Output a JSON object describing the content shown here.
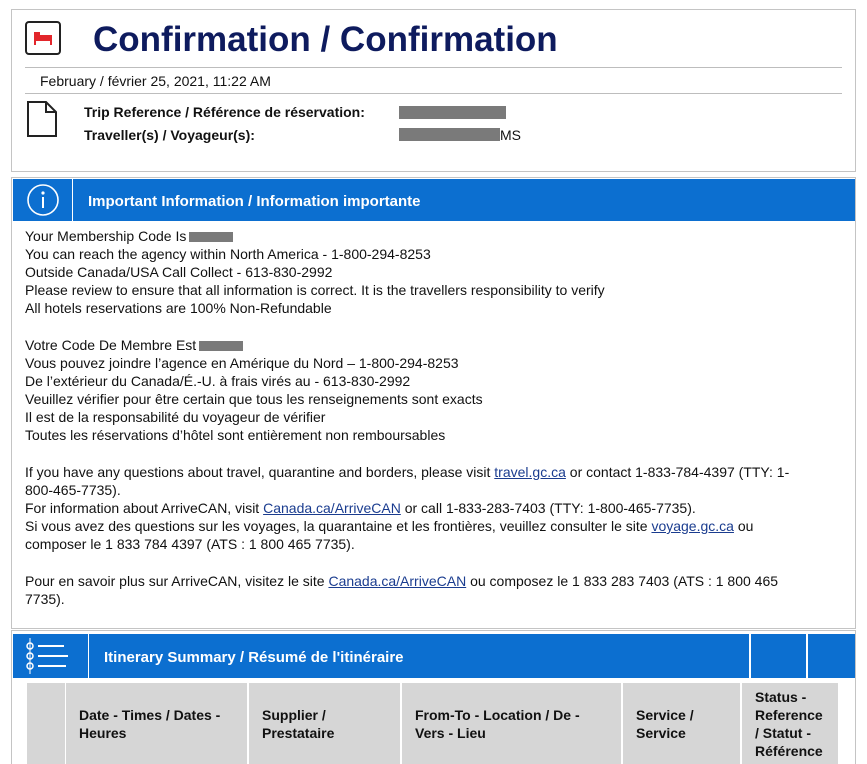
{
  "header": {
    "title": "Confirmation / Confirmation",
    "date": "February / février 25, 2021, 11:22 AM",
    "trip_reference_label": "Trip Reference / Référence de réservation:",
    "travellers_label": "Traveller(s) / Voyageur(s):",
    "traveller_suffix": "MS"
  },
  "info": {
    "title": "Important Information / Information importante",
    "lines": {
      "en_membership": "Your Membership Code Is",
      "en_reach": "You can reach the agency within North America - 1-800-294-8253",
      "en_outside": "Outside Canada/USA Call Collect - 613-830-2992",
      "en_review": "Please review to ensure that all information is correct. It is the travellers responsibility to verify",
      "en_hotels": "All hotels reservations are 100% Non-Refundable",
      "fr_membership": "Votre Code De Membre Est",
      "fr_reach": "Vous pouvez joindre l’agence en Amérique du Nord – 1-800-294-8253",
      "fr_outside": "De l’extérieur du Canada/É.-U. à frais virés au - 613-830-2992",
      "fr_verify": "Veuillez vérifier pour être certain que tous les renseignements sont exacts",
      "fr_responsibility": "Il est de la responsabilité du voyageur de vérifier",
      "fr_hotels": "Toutes les réservations d’hôtel sont entièrement non remboursables",
      "travel_q_pre": "If you have any questions about travel, quarantine and borders, please visit ",
      "travel_q_link": "travel.gc.ca",
      "travel_q_post": " or contact 1-833-784-4397 (TTY: 1-",
      "travel_q_cont": "800-465-7735).",
      "arrive_pre": "For information about ArriveCAN, visit ",
      "arrive_link": "Canada.ca/ArriveCAN",
      "arrive_post": " or call 1-833-283-7403 (TTY: 1-800-465-7735).",
      "voyage_pre": "Si vous avez des questions sur les voyages, la quarantaine et les frontières, veuillez consulter le site ",
      "voyage_link": "voyage.gc.ca",
      "voyage_post": " ou",
      "voyage_cont": "composer le 1 833 784 4397 (ATS : 1 800 465 7735).",
      "arrive_fr_pre": "Pour en savoir plus sur ArriveCAN, visitez le site ",
      "arrive_fr_link": "Canada.ca/ArriveCAN",
      "arrive_fr_post": " ou composez le 1 833 283 7403 (ATS : 1 800 465",
      "arrive_fr_cont": "7735)."
    }
  },
  "itinerary": {
    "title": "Itinerary Summary / Résumé de l'itinéraire",
    "columns": {
      "date_1": "Date - Times / Dates -",
      "date_2": "Heures",
      "supplier_1": "Supplier /",
      "supplier_2": "Prestataire",
      "location_1": "From-To - Location / De -",
      "location_2": "Vers - Lieu",
      "service_1": "Service /",
      "service_2": "Service",
      "status_1": "Status -",
      "status_2": "Reference",
      "status_3": "/ Statut -",
      "status_4": "Référence"
    }
  },
  "colors": {
    "brand_blue": "#0c6fd0",
    "title_navy": "#0e1b5e",
    "header_gray": "#d6d6d6",
    "link": "#1a3c8f"
  },
  "icons": [
    "hotel-icon",
    "document-icon",
    "info-icon",
    "list-icon"
  ]
}
